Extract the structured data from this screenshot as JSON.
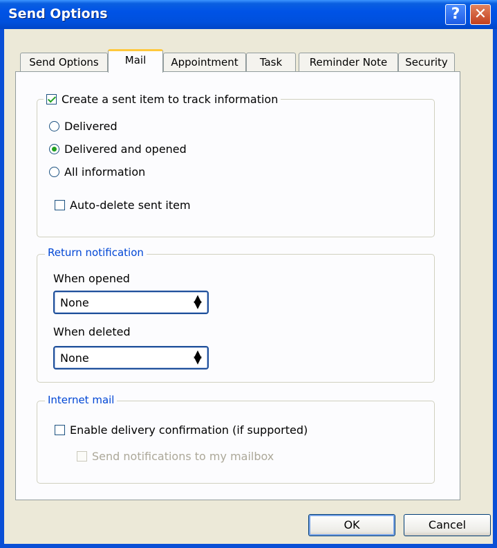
{
  "window": {
    "title": "Send Options",
    "help_glyph": "?",
    "close_glyph": "✕"
  },
  "tabs": [
    {
      "label": "Send Options",
      "active": false
    },
    {
      "label": "Mail",
      "active": true
    },
    {
      "label": "Appointment",
      "active": false
    },
    {
      "label": "Task",
      "active": false
    },
    {
      "label": "Reminder Note",
      "active": false
    },
    {
      "label": "Security",
      "active": false
    }
  ],
  "tracking": {
    "create_sent_item_label": "Create a sent item to track information",
    "create_sent_item_checked": true,
    "options": [
      {
        "label": "Delivered",
        "selected": false
      },
      {
        "label": "Delivered and opened",
        "selected": true
      },
      {
        "label": "All information",
        "selected": false
      }
    ],
    "auto_delete_label": "Auto-delete sent item",
    "auto_delete_checked": false
  },
  "return_notification": {
    "legend": "Return notification",
    "when_opened_label": "When opened",
    "when_opened_value": "None",
    "when_deleted_label": "When deleted",
    "when_deleted_value": "None"
  },
  "internet_mail": {
    "legend": "Internet mail",
    "enable_confirmation_label": "Enable delivery confirmation (if supported)",
    "enable_confirmation_checked": false,
    "send_notifications_label": "Send notifications to my mailbox",
    "send_notifications_checked": false,
    "send_notifications_enabled": false
  },
  "buttons": {
    "ok": "OK",
    "cancel": "Cancel"
  },
  "colors": {
    "titlebar": "#0053e6",
    "legend_blue": "#0046d5",
    "check_green": "#21a121",
    "active_tab_highlight": "#ffc83c"
  }
}
